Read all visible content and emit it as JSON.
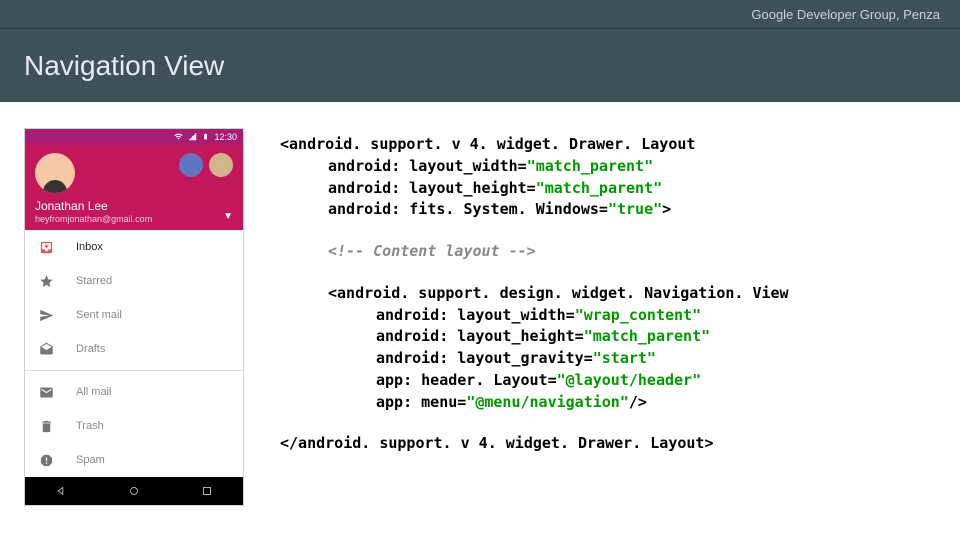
{
  "topbar": {
    "text": "Google Developer Group, Penza"
  },
  "titlebar": {
    "text": "Navigation View"
  },
  "phone": {
    "status": {
      "time": "12:30"
    },
    "header": {
      "name": "Jonathan Lee",
      "email": "heyfromjonathan@gmail.com"
    },
    "nav": [
      {
        "icon": "move-to-inbox",
        "label": "Inbox",
        "emphasis": true
      },
      {
        "icon": "star",
        "label": "Starred"
      },
      {
        "icon": "send",
        "label": "Sent mail"
      },
      {
        "icon": "drafts",
        "label": "Drafts"
      },
      {
        "divider": true
      },
      {
        "icon": "mail",
        "label": "All mail"
      },
      {
        "icon": "delete",
        "label": "Trash"
      },
      {
        "icon": "report",
        "label": "Spam"
      }
    ]
  },
  "code": {
    "open_tag": "<android. support. v 4. widget. Drawer. Layout",
    "attr1_k": "android: layout_width=",
    "attr1_v": "\"match_parent\"",
    "attr2_k": "android: layout_height=",
    "attr2_v": "\"match_parent\"",
    "attr3_k": "android: fits. System. Windows=",
    "attr3_v": "\"true\"",
    "open_close": ">",
    "comment": "<!-- Content layout -->",
    "nv_open": "<android. support. design. widget. Navigation. View",
    "nv_a1_k": "android: layout_width=",
    "nv_a1_v": "\"wrap_content\"",
    "nv_a2_k": "android: layout_height=",
    "nv_a2_v": "\"match_parent\"",
    "nv_a3_k": "android: layout_gravity=",
    "nv_a3_v": "\"start\"",
    "nv_a4_k": "app: header. Layout=",
    "nv_a4_v": "\"@layout/header\"",
    "nv_a5_k": "app: menu=",
    "nv_a5_v": "\"@menu/navigation\"",
    "nv_selfclose": "/>",
    "close_tag": "</android. support. v 4. widget. Drawer. Layout>"
  }
}
